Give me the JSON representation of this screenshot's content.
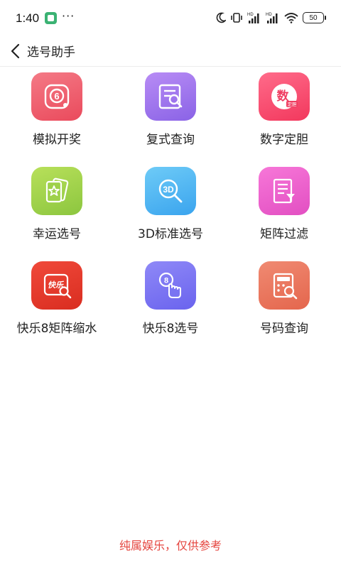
{
  "status_bar": {
    "time": "1:40",
    "dots": "···",
    "battery": "50"
  },
  "app_bar": {
    "title": "选号助手"
  },
  "tiles": [
    {
      "label": "模拟开奖",
      "icon": "lottery-ball-icon",
      "gradient": [
        "#f47a86",
        "#ea4a5c"
      ]
    },
    {
      "label": "复式查询",
      "icon": "document-search-icon",
      "gradient": [
        "#b88cf5",
        "#8a63e6"
      ]
    },
    {
      "label": "数字定胆",
      "icon": "number-lock-icon",
      "gradient": [
        "#ff6b8a",
        "#f2385d"
      ]
    },
    {
      "label": "幸运选号",
      "icon": "lucky-cards-icon",
      "gradient": [
        "#b8e05a",
        "#8cc63f"
      ]
    },
    {
      "label": "3D标准选号",
      "icon": "3d-search-icon",
      "gradient": [
        "#6ecbf7",
        "#3aa4ee"
      ]
    },
    {
      "label": "矩阵过滤",
      "icon": "filter-document-icon",
      "gradient": [
        "#f777d8",
        "#e24fc2"
      ]
    },
    {
      "label": "快乐8矩阵缩水",
      "icon": "happy8-matrix-icon",
      "gradient": [
        "#f0493a",
        "#d92d20"
      ]
    },
    {
      "label": "快乐8选号",
      "icon": "tap-number-icon",
      "gradient": [
        "#8f89f7",
        "#6a63ee"
      ]
    },
    {
      "label": "号码查询",
      "icon": "calculator-search-icon",
      "gradient": [
        "#f08a72",
        "#e4664d"
      ]
    }
  ],
  "footer": {
    "note": "纯属娱乐，仅供参考"
  }
}
